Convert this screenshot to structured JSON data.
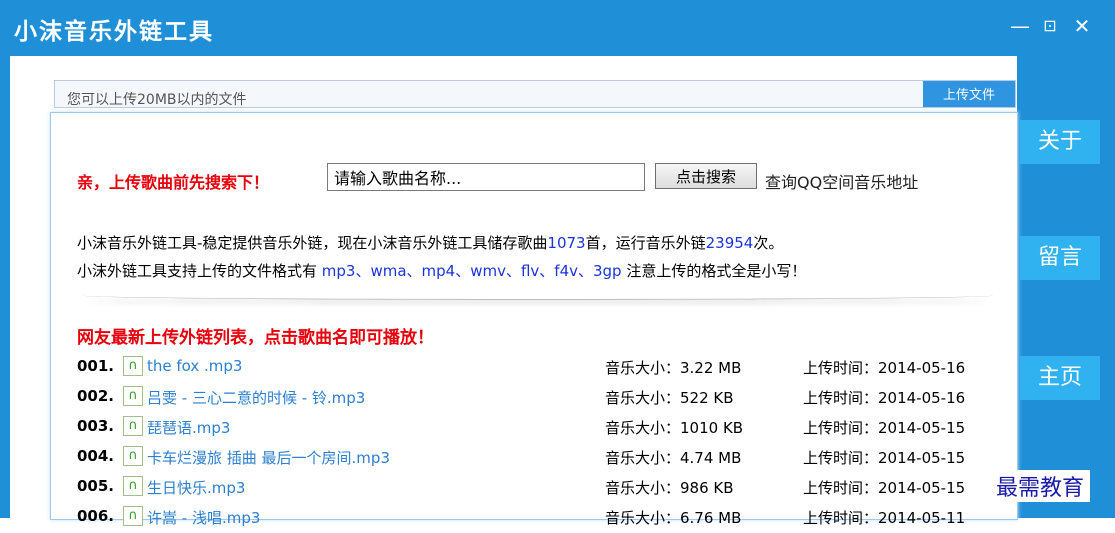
{
  "window": {
    "title": "小沫音乐外链工具",
    "minimize": "—",
    "restore": "⊡",
    "close": "✕"
  },
  "hidden_bar": {
    "text": "您可以上传20MB以内的文件",
    "button": "上传文件"
  },
  "search": {
    "label": "亲，上传歌曲前先搜索下！",
    "placeholder": "请输入歌曲名称...",
    "value": "请输入歌曲名称...",
    "button": "点击搜索",
    "qq_link": "查询QQ空间音乐地址"
  },
  "intro": {
    "line1_a": "小沫音乐外链工具-稳定提供音乐外链，现在小沫音乐外链工具储存歌曲",
    "song_count": "1073",
    "line1_b": "首，运行音乐外链",
    "run_count": "23954",
    "line1_c": "次。",
    "line2_a": "小沫外链工具支持上传的文件格式有 ",
    "formats": "mp3、wma、mp4、wmv、flv、f4v、3gp",
    "line2_b": " 注意上传的格式全是小写！"
  },
  "list_title": "网友最新上传外链列表，点击歌曲名即可播放！",
  "songs": [
    {
      "num": "001.",
      "name": "the fox .mp3",
      "size": "音乐大小：3.22 MB",
      "time": "上传时间：2014-05-16"
    },
    {
      "num": "002.",
      "name": "吕雯 - 三心二意的时候 - 铃.mp3",
      "size": "音乐大小：522 KB",
      "time": "上传时间：2014-05-16"
    },
    {
      "num": "003.",
      "name": "琵琶语.mp3",
      "size": "音乐大小：1010 KB",
      "time": "上传时间：2014-05-15"
    },
    {
      "num": "004.",
      "name": "卡车烂漫旅 插曲 最后一个房间.mp3",
      "size": "音乐大小：4.74 MB",
      "time": "上传时间：2014-05-15"
    },
    {
      "num": "005.",
      "name": "生日快乐.mp3",
      "size": "音乐大小：986 KB",
      "time": "上传时间：2014-05-15"
    },
    {
      "num": "006.",
      "name": "许嵩 - 浅唱.mp3",
      "size": "音乐大小：6.76 MB",
      "time": "上传时间：2014-05-11"
    }
  ],
  "side_buttons": {
    "about": "关于",
    "message": "留言",
    "home": "主页"
  },
  "watermark": "最需教育",
  "colors": {
    "frame_blue": "#1f8fd8",
    "side_button": "#30b2f0",
    "red_text": "#e8000b",
    "link_blue": "#2d7fcf",
    "highlight_blue": "#1a33e0"
  }
}
